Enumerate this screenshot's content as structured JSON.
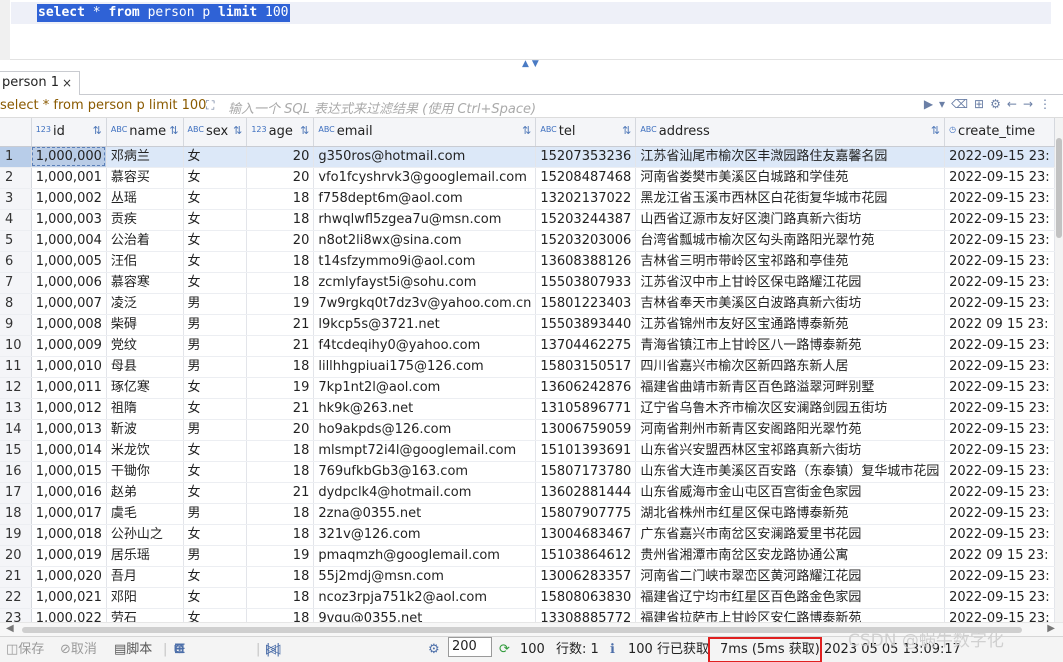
{
  "editor": {
    "sql_parts": [
      "select",
      " * ",
      "from",
      " person p ",
      "limit",
      " 100"
    ]
  },
  "tabs": [
    {
      "label": "person 1",
      "close": "×"
    }
  ],
  "filter": {
    "query": "select * from person p limit 100",
    "placeholder": "输入一个 SQL 表达式来过滤结果 (使用 Ctrl+Space)"
  },
  "columns": [
    {
      "type": "123",
      "name": "id",
      "sort": "⇅"
    },
    {
      "type": "ABC",
      "name": "name",
      "sort": "⇅"
    },
    {
      "type": "ABC",
      "name": "sex",
      "sort": "⇅"
    },
    {
      "type": "123",
      "name": "age",
      "sort": "⇅"
    },
    {
      "type": "ABC",
      "name": "email",
      "sort": "⇅"
    },
    {
      "type": "ABC",
      "name": "tel",
      "sort": "⇅"
    },
    {
      "type": "ABC",
      "name": "address",
      "sort": "⇅"
    },
    {
      "type": "◷",
      "name": "create_time",
      "sort": ""
    }
  ],
  "rows": [
    [
      "1",
      "1,000,000",
      "邓病兰",
      "女",
      "20",
      "g350ros@hotmail.com",
      "15207353236",
      "江苏省汕尾市榆次区丰溦园路住友嘉馨名园",
      "2022-09-15 23:"
    ],
    [
      "2",
      "1,000,001",
      "慕容买",
      "女",
      "20",
      "vfo1fcyshrvk3@googlemail.com",
      "15208487468",
      "河南省娄樊市美溪区白城路和学佳苑",
      "2022-09-15 23:"
    ],
    [
      "3",
      "1,000,002",
      "丛瑶",
      "女",
      "18",
      "f758dept6m@aol.com",
      "13202137022",
      "黑龙江省玉溪市西林区白花街复华城市花园",
      "2022-09-15 23:"
    ],
    [
      "4",
      "1,000,003",
      "贡疾",
      "女",
      "18",
      "rhwqlwfl5zgea7u@msn.com",
      "15203244387",
      "山西省辽源市友好区澳门路真新六街坊",
      "2022-09-15 23:"
    ],
    [
      "5",
      "1,000,004",
      "公治着",
      "女",
      "20",
      "n8ot2li8wx@sina.com",
      "15203203006",
      "台湾省瓢城市榆次区勾头南路阳光翠竹苑",
      "2022-09-15 23:"
    ],
    [
      "6",
      "1,000,005",
      "汪佀",
      "女",
      "18",
      "t14sfzymmo9i@aol.com",
      "13608388126",
      "吉林省三明市带岭区宝祁路和亭佳苑",
      "2022-09-15 23:"
    ],
    [
      "7",
      "1,000,006",
      "慕容寒",
      "女",
      "18",
      "zcmlyfayst5i@sohu.com",
      "15503807933",
      "江苏省汉中市上甘岭区保屯路耀江花园",
      "2022-09-15 23:"
    ],
    [
      "8",
      "1,000,007",
      "凌泛",
      "男",
      "19",
      "7w9rgkq0t7dz3v@yahoo.com.cn",
      "15801223403",
      "吉林省奉天市美溪区白波路真新六街坊",
      "2022-09-15 23:"
    ],
    [
      "9",
      "1,000,008",
      "柴碍",
      "男",
      "21",
      "l9kcp5s@3721.net",
      "15503893440",
      "江苏省锦州市友好区宝通路博泰新苑",
      "2022 09 15 23:"
    ],
    [
      "10",
      "1,000,009",
      "党纹",
      "男",
      "21",
      "f4tcdeqihy0@yahoo.com",
      "13704462275",
      "青海省镇江市上甘岭区八一路博泰新苑",
      "2022-09-15 23:"
    ],
    [
      "11",
      "1,000,010",
      "母县",
      "男",
      "18",
      "lillhhgpiuai175@126.com",
      "15803150517",
      "四川省嘉兴市榆次区新四路东新人居",
      "2022-09-15 23:"
    ],
    [
      "12",
      "1,000,011",
      "琢亿寒",
      "女",
      "19",
      "7kp1nt2l@aol.com",
      "13606242876",
      "福建省曲靖市新青区百色路溢翠河畔别墅",
      "2022-09-15 23:"
    ],
    [
      "13",
      "1,000,012",
      "祖隋",
      "女",
      "21",
      "hk9k@263.net",
      "13105896771",
      "辽宁省乌鲁木齐市榆次区安澜路剑园五街坊",
      "2022-09-15 23:"
    ],
    [
      "14",
      "1,000,013",
      "靳波",
      "男",
      "20",
      "ho9akpds@126.com",
      "13006759059",
      "河南省荆州市新青区安阁路阳光翠竹苑",
      "2022-09-15 23:"
    ],
    [
      "15",
      "1,000,014",
      "米龙饮",
      "女",
      "18",
      "mlsmpt72i4l@googlemail.com",
      "15101393691",
      "山东省兴安盟西林区宝祁路真新六街坊",
      "2022-09-15 23:"
    ],
    [
      "16",
      "1,000,015",
      "干锄你",
      "女",
      "18",
      "769ufkbGb3@163.com",
      "15807173780",
      "山东省大连市美溪区百安路（东泰镇）复华城市花园",
      "2022-09-15 23:"
    ],
    [
      "17",
      "1,000,016",
      "赵弟",
      "女",
      "21",
      "dydpclk4@hotmail.com",
      "13602881444",
      "山东省威海市金山屯区百宫街金色家园",
      "2022-09-15 23:"
    ],
    [
      "18",
      "1,000,017",
      "虞毛",
      "男",
      "18",
      "2zna@0355.net",
      "15807907775",
      "湖北省株州市红星区保屯路博泰新苑",
      "2022-09-15 23:"
    ],
    [
      "19",
      "1,000,018",
      "公孙山之",
      "女",
      "18",
      "321v@126.com",
      "13004683467",
      "广东省嘉兴市南岔区安澜路爱里书花园",
      "2022-09-15 23:"
    ],
    [
      "20",
      "1,000,019",
      "居乐瑶",
      "男",
      "19",
      "pmaqmzh@googlemail.com",
      "15103864612",
      "贵州省湘潭市南岔区安龙路协通公寓",
      "2022 09 15 23:"
    ],
    [
      "21",
      "1,000,020",
      "吾月",
      "女",
      "18",
      "55j2mdj@msn.com",
      "13006283357",
      "河南省二门峡市翠峦区黄河路耀江花园",
      "2022-09-15 23:"
    ],
    [
      "22",
      "1,000,021",
      "邓阳",
      "女",
      "18",
      "ncoz3rpja751k2@aol.com",
      "15808063830",
      "福建省辽宁均市红星区百色路金色家园",
      "2022-09-15 23:"
    ],
    [
      "23",
      "1,000,022",
      "劳石",
      "女",
      "18",
      "9vqu@0355.net",
      "13308885772",
      "福建省拉萨市上甘岭区安仁路博泰新苑",
      "2022-09-15 23:"
    ]
  ],
  "status": {
    "save": "保存",
    "cancel": "取消",
    "script": "脚本",
    "fetch_size": "200",
    "fetch_count": "100",
    "rows_label": "行数: 1",
    "fetched": "100 行已获取",
    "timing": "7ms (5ms 获取)",
    "datetime": "2023 05 05 13:09:17"
  },
  "watermark": "CSDN @蜗牛数字化",
  "colors": {
    "selection": "#2f62d6",
    "highlight_box": "#e02020"
  }
}
